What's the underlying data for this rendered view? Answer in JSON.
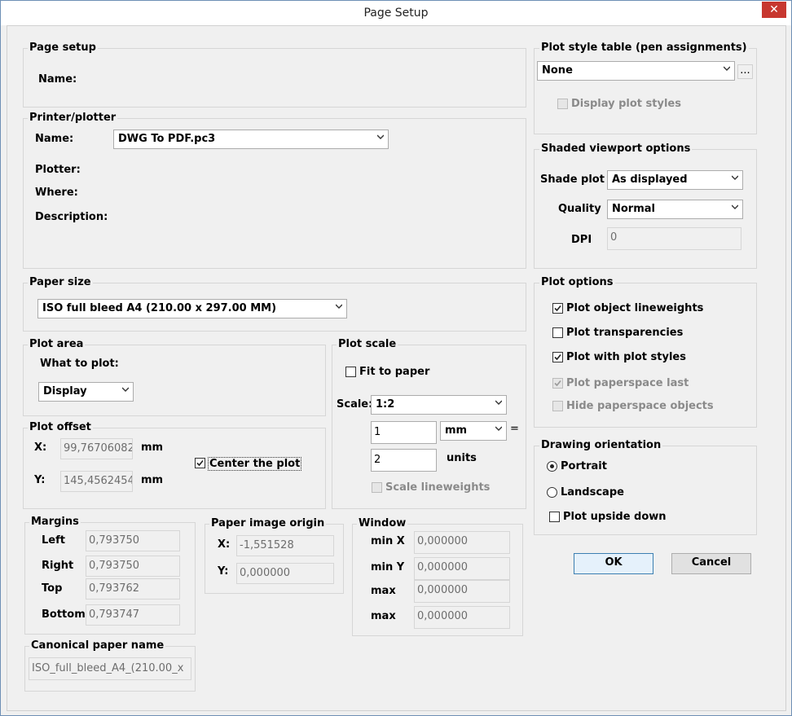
{
  "window": {
    "title": "Page Setup",
    "close_glyph": "✕"
  },
  "page_setup": {
    "legend": "Page setup",
    "name_label": "Name:"
  },
  "printer": {
    "legend": "Printer/plotter",
    "name_label": "Name:",
    "name_value": "DWG To PDF.pc3",
    "plotter_label": "Plotter:",
    "where_label": "Where:",
    "description_label": "Description:"
  },
  "paper_size": {
    "legend": "Paper size",
    "value": "ISO full bleed A4 (210.00 x 297.00 MM)"
  },
  "plot_area": {
    "legend": "Plot area",
    "what_label": "What to plot:",
    "what_value": "Display"
  },
  "plot_offset": {
    "legend": "Plot offset",
    "x_label": "X:",
    "x_value": "99,76706082",
    "x_unit": "mm",
    "y_label": "Y:",
    "y_value": "145,4562454",
    "y_unit": "mm",
    "center_label": "Center the plot",
    "center_checked": true
  },
  "margins": {
    "legend": "Margins",
    "left_label": "Left",
    "left_value": "0,793750",
    "right_label": "Right",
    "right_value": "0,793750",
    "top_label": "Top",
    "top_value": "0,793762",
    "bottom_label": "Bottom",
    "bottom_value": "0,793747"
  },
  "canonical": {
    "legend": "Canonical paper name",
    "value": "ISO_full_bleed_A4_(210.00_x"
  },
  "paper_origin": {
    "legend": "Paper image origin",
    "x_label": "X:",
    "x_value": "-1,551528",
    "y_label": "Y:",
    "y_value": "0,000000"
  },
  "plot_scale": {
    "legend": "Plot scale",
    "fit_label": "Fit to paper",
    "scale_label": "Scale:",
    "scale_value": "1:2",
    "num_value": "1",
    "unit_value": "mm",
    "equals": "=",
    "den_value": "2",
    "den_unit": "units",
    "lineweights_label": "Scale lineweights"
  },
  "window_group": {
    "legend": "Window",
    "minx_label": "min X",
    "minx_value": "0,000000",
    "miny_label": "min Y",
    "miny_value": "0,000000",
    "max1_label": "max",
    "max1_value": "0,000000",
    "max2_label": "max",
    "max2_value": "0,000000"
  },
  "plot_style": {
    "legend": "Plot style table (pen assignments)",
    "value": "None",
    "browse_label": "...",
    "display_label": "Display plot styles"
  },
  "shaded": {
    "legend": "Shaded viewport options",
    "shade_label": "Shade plot",
    "shade_value": "As displayed",
    "quality_label": "Quality",
    "quality_value": "Normal",
    "dpi_label": "DPI",
    "dpi_value": "0"
  },
  "plot_options": {
    "legend": "Plot options",
    "lineweights_label": "Plot object lineweights",
    "transparencies_label": "Plot transparencies",
    "plotstyles_label": "Plot with plot styles",
    "paperspace_last_label": "Plot paperspace last",
    "hide_label": "Hide paperspace objects"
  },
  "orientation": {
    "legend": "Drawing orientation",
    "portrait_label": "Portrait",
    "landscape_label": "Landscape",
    "upside_label": "Plot upside down"
  },
  "buttons": {
    "ok": "OK",
    "cancel": "Cancel"
  }
}
